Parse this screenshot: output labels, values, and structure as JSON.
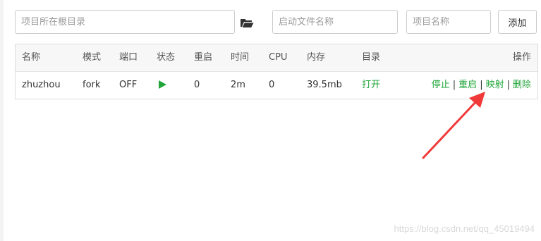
{
  "toolbar": {
    "path_placeholder": "项目所在根目录",
    "start_file_placeholder": "启动文件名称",
    "project_name_placeholder": "项目名称",
    "add_label": "添加",
    "folder_icon": "folder-open-icon"
  },
  "table": {
    "headers": {
      "name": "名称",
      "mode": "模式",
      "port": "端口",
      "status": "状态",
      "restart": "重启",
      "time": "时间",
      "cpu": "CPU",
      "memory": "内存",
      "directory": "目录",
      "operations": "操作"
    },
    "rows": [
      {
        "name": "zhuzhou",
        "mode": "fork",
        "port": "OFF",
        "status_icon": "play-icon",
        "restart": "0",
        "time": "2m",
        "cpu": "0",
        "memory": "39.5mb",
        "directory": "打开",
        "ops": {
          "stop": "停止",
          "restart": "重启",
          "map": "映射",
          "delete": "删除",
          "separator": "|"
        }
      }
    ]
  },
  "annotation": {
    "color": "#f03a3a"
  },
  "watermark": "https://blog.csdn.net/qq_45019494",
  "colors": {
    "accent": "#20a53a",
    "header_bg": "#f7f7f7",
    "border": "#dddddd"
  }
}
